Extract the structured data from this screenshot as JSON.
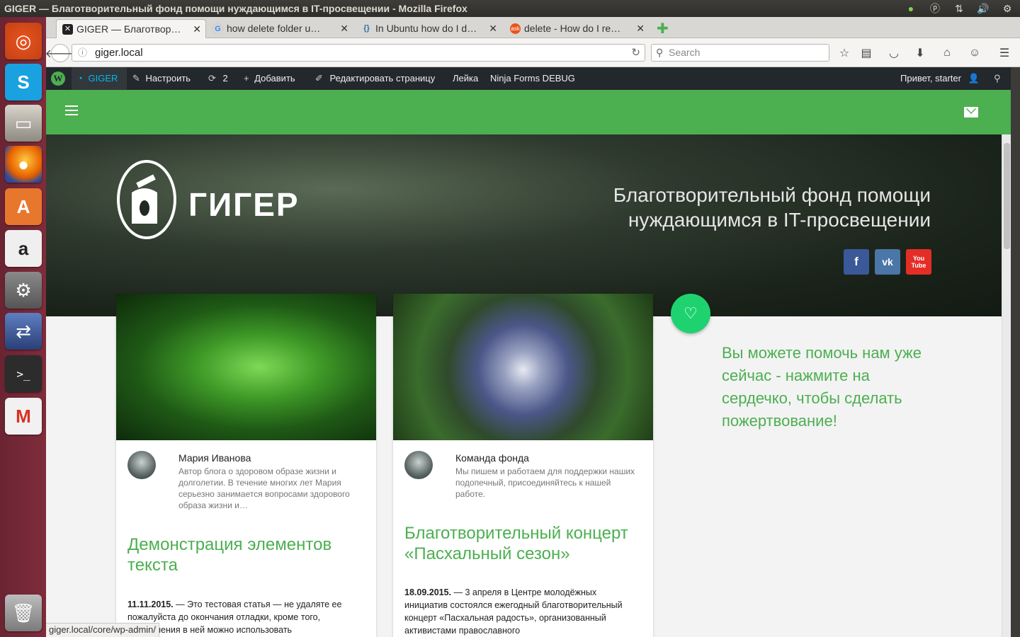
{
  "os": {
    "window_title": "GIGER — Благотворительный фонд помощи нуждающимся в IT-просвещении - Mozilla Firefox",
    "tray_icons": [
      "update-icon",
      "p-icon",
      "network-icon",
      "volume-icon",
      "gear-icon"
    ],
    "launcher_apps": [
      "ubuntu-icon",
      "skype-icon",
      "files-icon",
      "firefox-icon",
      "software-center-icon",
      "amazon-icon",
      "settings-icon",
      "remote-desktop-icon",
      "terminal-icon",
      "gmail-icon",
      "trash-icon"
    ]
  },
  "browser": {
    "tabs": [
      {
        "title": "GIGER — Благотвор…",
        "active": true
      },
      {
        "title": "how delete folder u…",
        "active": false
      },
      {
        "title": "In Ubuntu how do I d…",
        "active": false
      },
      {
        "title": "delete - How do I re…",
        "active": false
      }
    ],
    "url": "giger.local",
    "search_placeholder": "Search",
    "status_url": "giger.local/core/wp-admin/"
  },
  "wp_admin_bar": {
    "site": "GIGER",
    "customize": "Настроить",
    "updates": "2",
    "add": "Добавить",
    "edit_page": "Редактировать страницу",
    "watering": "Лейка",
    "ninja": "Ninja Forms DEBUG",
    "greeting": "Привет, starter"
  },
  "site": {
    "logo_text": "ГИГЕР",
    "tagline_line1": "Благотворительный фонд помощи",
    "tagline_line2": "нуждающимся в IT-просвещении",
    "social": [
      "f",
      "vk",
      "You Tube"
    ],
    "donate_text": "Вы можете помочь нам уже сейчас - нажмите на сердечко, чтобы сделать пожертвование!"
  },
  "posts": [
    {
      "author": "Мария Иванова",
      "bio": "Автор блога о здоровом образе жизни и долголетии. В течение многих лет Мария серьезно занимается вопросами здорового образа жизни и…",
      "title": "Демонстрация элементов текста",
      "date": "11.11.2015.",
      "excerpt": " — Это тестовая статья — не удаляте ее пожалуйста до окончания отладки, кроме того, оформления в ней можно использовать"
    },
    {
      "author": "Команда фонда",
      "bio": "Мы пишем и работаем для поддержки наших подопечный, присоединяйтесь к нашей работе.",
      "title": "Благотворительный концерт «Пасхальный сезон»",
      "date": "18.09.2015.",
      "excerpt": " — 3 апреля в Центре молодёжных инициатив состоялся ежегодный благотворительный концерт «Пасхальная радость», организованный активистами православного"
    }
  ]
}
